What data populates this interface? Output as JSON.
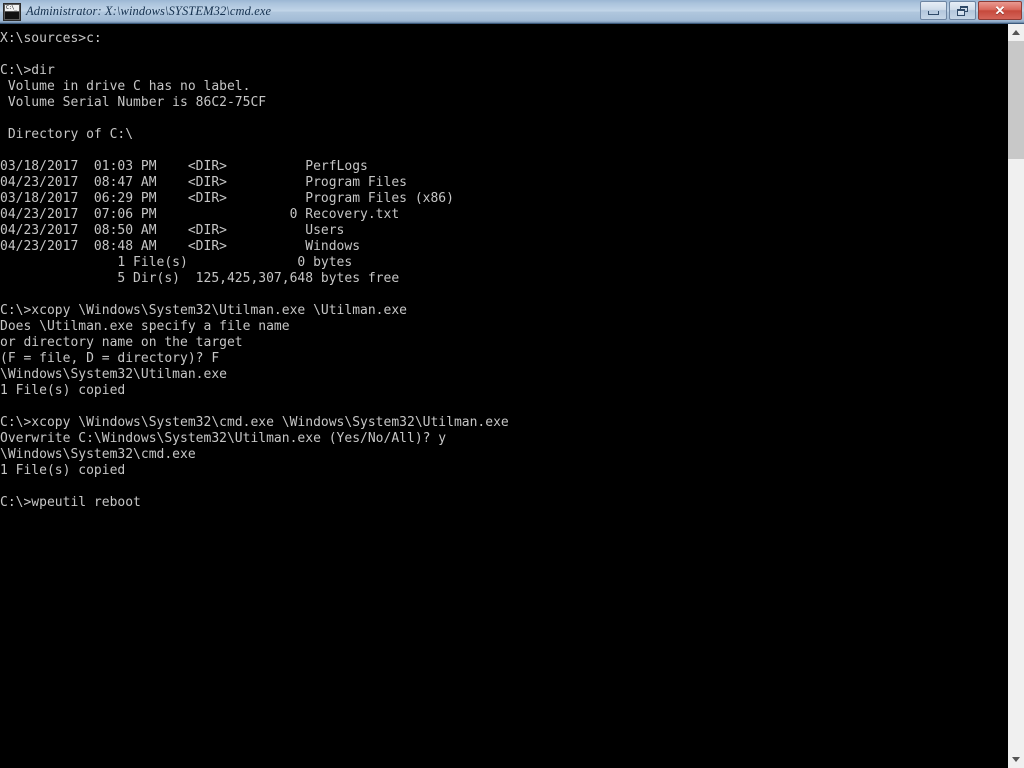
{
  "window": {
    "title": "Administrator: X:\\windows\\SYSTEM32\\cmd.exe",
    "icon": "cmd-icon",
    "icon_label": "C:\\_",
    "colors": {
      "console_background": "#000000",
      "console_text": "#c6c6c6",
      "titlebar_top": "#9cb7d4",
      "titlebar_mid": "#c2d5e8",
      "titlebar_bottom": "#89a4c2",
      "title_text": "#15314f",
      "close_button": "#c6493c",
      "scrollbar_track": "#f0f0f0",
      "scrollbar_thumb": "#c8c8c8"
    },
    "controls": {
      "minimize": "Minimize",
      "restore": "Restore",
      "close": "Close",
      "close_glyph": "✕"
    }
  },
  "scrollbar": {
    "up_arrow": "scroll-up",
    "down_arrow": "scroll-down",
    "thumb": "scroll-thumb"
  },
  "console": {
    "lines": [
      "X:\\sources>c:",
      "",
      "C:\\>dir",
      " Volume in drive C has no label.",
      " Volume Serial Number is 86C2-75CF",
      "",
      " Directory of C:\\",
      "",
      "03/18/2017  01:03 PM    <DIR>          PerfLogs",
      "04/23/2017  08:47 AM    <DIR>          Program Files",
      "03/18/2017  06:29 PM    <DIR>          Program Files (x86)",
      "04/23/2017  07:06 PM                 0 Recovery.txt",
      "04/23/2017  08:50 AM    <DIR>          Users",
      "04/23/2017  08:48 AM    <DIR>          Windows",
      "               1 File(s)              0 bytes",
      "               5 Dir(s)  125,425,307,648 bytes free",
      "",
      "C:\\>xcopy \\Windows\\System32\\Utilman.exe \\Utilman.exe",
      "Does \\Utilman.exe specify a file name",
      "or directory name on the target",
      "(F = file, D = directory)? F",
      "\\Windows\\System32\\Utilman.exe",
      "1 File(s) copied",
      "",
      "C:\\>xcopy \\Windows\\System32\\cmd.exe \\Windows\\System32\\Utilman.exe",
      "Overwrite C:\\Windows\\System32\\Utilman.exe (Yes/No/All)? y",
      "\\Windows\\System32\\cmd.exe",
      "1 File(s) copied",
      "",
      "C:\\>wpeutil reboot"
    ],
    "text": "X:\\sources>c:\n\nC:\\>dir\n Volume in drive C has no label.\n Volume Serial Number is 86C2-75CF\n\n Directory of C:\\\n\n03/18/2017  01:03 PM    <DIR>          PerfLogs\n04/23/2017  08:47 AM    <DIR>          Program Files\n03/18/2017  06:29 PM    <DIR>          Program Files (x86)\n04/23/2017  07:06 PM                 0 Recovery.txt\n04/23/2017  08:50 AM    <DIR>          Users\n04/23/2017  08:48 AM    <DIR>          Windows\n               1 File(s)              0 bytes\n               5 Dir(s)  125,425,307,648 bytes free\n\nC:\\>xcopy \\Windows\\System32\\Utilman.exe \\Utilman.exe\nDoes \\Utilman.exe specify a file name\nor directory name on the target\n(F = file, D = directory)? F\n\\Windows\\System32\\Utilman.exe\n1 File(s) copied\n\nC:\\>xcopy \\Windows\\System32\\cmd.exe \\Windows\\System32\\Utilman.exe\nOverwrite C:\\Windows\\System32\\Utilman.exe (Yes/No/All)? y\n\\Windows\\System32\\cmd.exe\n1 File(s) copied\n\nC:\\>wpeutil reboot"
  }
}
